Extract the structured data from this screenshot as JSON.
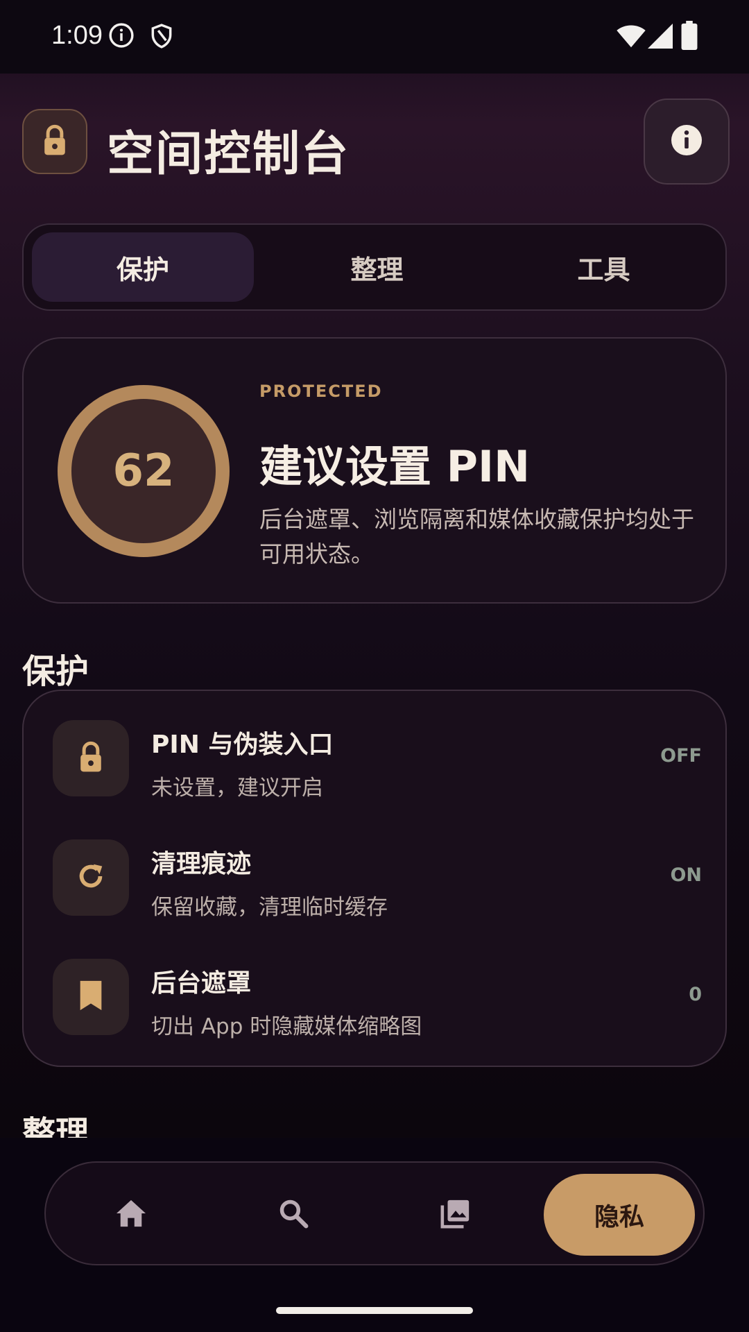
{
  "status_bar": {
    "time": "1:09"
  },
  "header": {
    "title": "空间控制台"
  },
  "tabs": [
    {
      "label": "保护",
      "active": true
    },
    {
      "label": "整理",
      "active": false
    },
    {
      "label": "工具",
      "active": false
    }
  ],
  "status_card": {
    "score": "62",
    "score_fraction": 1.0,
    "kicker": "PROTECTED",
    "title": "建议设置 PIN",
    "description": "后台遮罩、浏览隔离和媒体收藏保护均处于可用状态。"
  },
  "sections": {
    "protect_title": "保护",
    "organize_title": "整理"
  },
  "protect_items": [
    {
      "title": "PIN 与伪装入口",
      "subtitle": "未设置，建议开启",
      "value": "OFF",
      "icon": "lock-icon"
    },
    {
      "title": "清理痕迹",
      "subtitle": "保留收藏，清理临时缓存",
      "value": "ON",
      "icon": "refresh-icon"
    },
    {
      "title": "后台遮罩",
      "subtitle": "切出 App 时隐藏媒体缩略图",
      "value": "0",
      "icon": "bookmark-icon"
    }
  ],
  "bottom_nav": {
    "items": [
      {
        "icon": "home-icon"
      },
      {
        "icon": "search-icon"
      },
      {
        "icon": "gallery-icon"
      }
    ],
    "privacy_label": "隐私"
  },
  "colors": {
    "accent": "#c89b67",
    "background": "#150b1a",
    "card": "#1a0f1c"
  }
}
